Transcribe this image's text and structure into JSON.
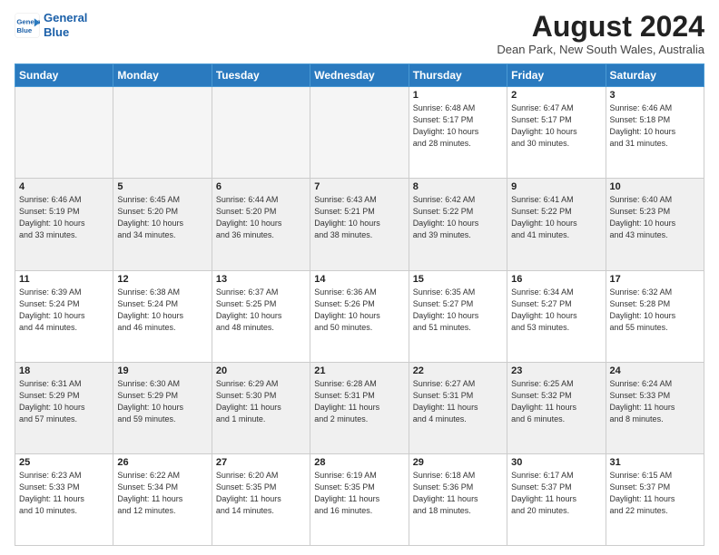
{
  "logo": {
    "line1": "General",
    "line2": "Blue"
  },
  "title": "August 2024",
  "location": "Dean Park, New South Wales, Australia",
  "weekdays": [
    "Sunday",
    "Monday",
    "Tuesday",
    "Wednesday",
    "Thursday",
    "Friday",
    "Saturday"
  ],
  "weeks": [
    [
      {
        "day": "",
        "info": "",
        "empty": true
      },
      {
        "day": "",
        "info": "",
        "empty": true
      },
      {
        "day": "",
        "info": "",
        "empty": true
      },
      {
        "day": "",
        "info": "",
        "empty": true
      },
      {
        "day": "1",
        "info": "Sunrise: 6:48 AM\nSunset: 5:17 PM\nDaylight: 10 hours\nand 28 minutes."
      },
      {
        "day": "2",
        "info": "Sunrise: 6:47 AM\nSunset: 5:17 PM\nDaylight: 10 hours\nand 30 minutes."
      },
      {
        "day": "3",
        "info": "Sunrise: 6:46 AM\nSunset: 5:18 PM\nDaylight: 10 hours\nand 31 minutes."
      }
    ],
    [
      {
        "day": "4",
        "info": "Sunrise: 6:46 AM\nSunset: 5:19 PM\nDaylight: 10 hours\nand 33 minutes."
      },
      {
        "day": "5",
        "info": "Sunrise: 6:45 AM\nSunset: 5:20 PM\nDaylight: 10 hours\nand 34 minutes."
      },
      {
        "day": "6",
        "info": "Sunrise: 6:44 AM\nSunset: 5:20 PM\nDaylight: 10 hours\nand 36 minutes."
      },
      {
        "day": "7",
        "info": "Sunrise: 6:43 AM\nSunset: 5:21 PM\nDaylight: 10 hours\nand 38 minutes."
      },
      {
        "day": "8",
        "info": "Sunrise: 6:42 AM\nSunset: 5:22 PM\nDaylight: 10 hours\nand 39 minutes."
      },
      {
        "day": "9",
        "info": "Sunrise: 6:41 AM\nSunset: 5:22 PM\nDaylight: 10 hours\nand 41 minutes."
      },
      {
        "day": "10",
        "info": "Sunrise: 6:40 AM\nSunset: 5:23 PM\nDaylight: 10 hours\nand 43 minutes."
      }
    ],
    [
      {
        "day": "11",
        "info": "Sunrise: 6:39 AM\nSunset: 5:24 PM\nDaylight: 10 hours\nand 44 minutes."
      },
      {
        "day": "12",
        "info": "Sunrise: 6:38 AM\nSunset: 5:24 PM\nDaylight: 10 hours\nand 46 minutes."
      },
      {
        "day": "13",
        "info": "Sunrise: 6:37 AM\nSunset: 5:25 PM\nDaylight: 10 hours\nand 48 minutes."
      },
      {
        "day": "14",
        "info": "Sunrise: 6:36 AM\nSunset: 5:26 PM\nDaylight: 10 hours\nand 50 minutes."
      },
      {
        "day": "15",
        "info": "Sunrise: 6:35 AM\nSunset: 5:27 PM\nDaylight: 10 hours\nand 51 minutes."
      },
      {
        "day": "16",
        "info": "Sunrise: 6:34 AM\nSunset: 5:27 PM\nDaylight: 10 hours\nand 53 minutes."
      },
      {
        "day": "17",
        "info": "Sunrise: 6:32 AM\nSunset: 5:28 PM\nDaylight: 10 hours\nand 55 minutes."
      }
    ],
    [
      {
        "day": "18",
        "info": "Sunrise: 6:31 AM\nSunset: 5:29 PM\nDaylight: 10 hours\nand 57 minutes."
      },
      {
        "day": "19",
        "info": "Sunrise: 6:30 AM\nSunset: 5:29 PM\nDaylight: 10 hours\nand 59 minutes."
      },
      {
        "day": "20",
        "info": "Sunrise: 6:29 AM\nSunset: 5:30 PM\nDaylight: 11 hours\nand 1 minute."
      },
      {
        "day": "21",
        "info": "Sunrise: 6:28 AM\nSunset: 5:31 PM\nDaylight: 11 hours\nand 2 minutes."
      },
      {
        "day": "22",
        "info": "Sunrise: 6:27 AM\nSunset: 5:31 PM\nDaylight: 11 hours\nand 4 minutes."
      },
      {
        "day": "23",
        "info": "Sunrise: 6:25 AM\nSunset: 5:32 PM\nDaylight: 11 hours\nand 6 minutes."
      },
      {
        "day": "24",
        "info": "Sunrise: 6:24 AM\nSunset: 5:33 PM\nDaylight: 11 hours\nand 8 minutes."
      }
    ],
    [
      {
        "day": "25",
        "info": "Sunrise: 6:23 AM\nSunset: 5:33 PM\nDaylight: 11 hours\nand 10 minutes."
      },
      {
        "day": "26",
        "info": "Sunrise: 6:22 AM\nSunset: 5:34 PM\nDaylight: 11 hours\nand 12 minutes."
      },
      {
        "day": "27",
        "info": "Sunrise: 6:20 AM\nSunset: 5:35 PM\nDaylight: 11 hours\nand 14 minutes."
      },
      {
        "day": "28",
        "info": "Sunrise: 6:19 AM\nSunset: 5:35 PM\nDaylight: 11 hours\nand 16 minutes."
      },
      {
        "day": "29",
        "info": "Sunrise: 6:18 AM\nSunset: 5:36 PM\nDaylight: 11 hours\nand 18 minutes."
      },
      {
        "day": "30",
        "info": "Sunrise: 6:17 AM\nSunset: 5:37 PM\nDaylight: 11 hours\nand 20 minutes."
      },
      {
        "day": "31",
        "info": "Sunrise: 6:15 AM\nSunset: 5:37 PM\nDaylight: 11 hours\nand 22 minutes."
      }
    ]
  ]
}
